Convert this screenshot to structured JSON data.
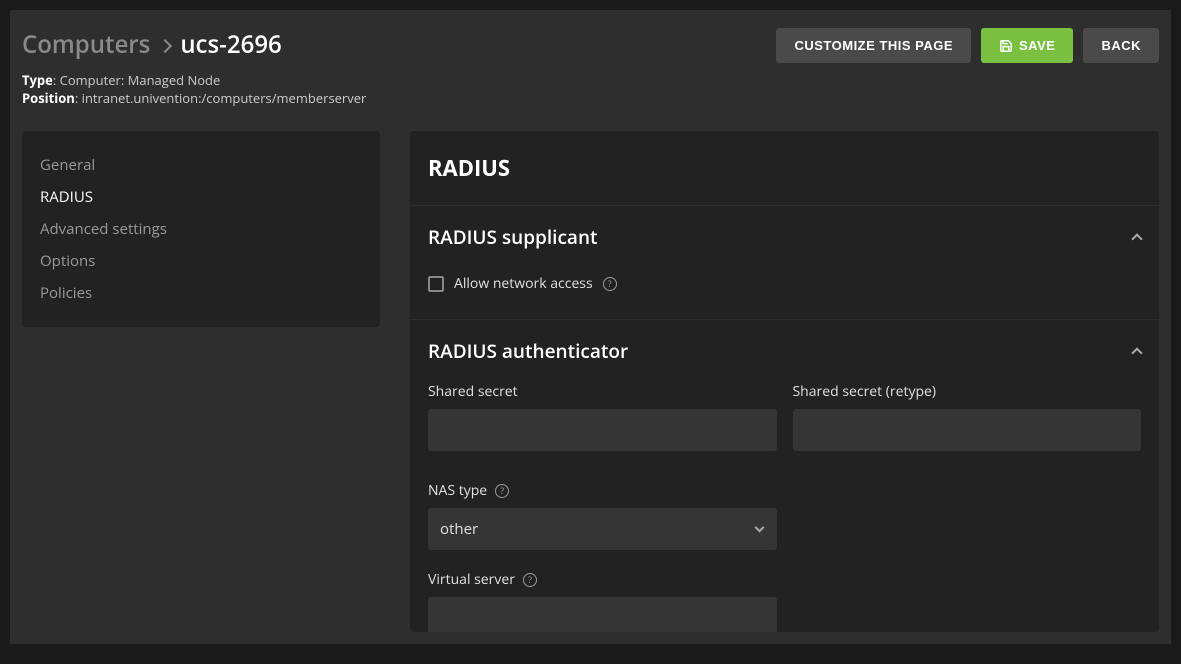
{
  "header": {
    "breadcrumb": {
      "parent": "Computers",
      "current": "ucs-2696"
    },
    "meta": {
      "type_label": "Type",
      "type_value": "Computer: Managed Node",
      "position_label": "Position",
      "position_value": "intranet.univention:/computers/memberserver"
    },
    "actions": {
      "customize": "CUSTOMIZE THIS PAGE",
      "save": "SAVE",
      "back": "BACK"
    }
  },
  "sidebar": {
    "items": [
      {
        "label": "General",
        "active": false
      },
      {
        "label": "RADIUS",
        "active": true
      },
      {
        "label": "Advanced settings",
        "active": false
      },
      {
        "label": "Options",
        "active": false
      },
      {
        "label": "Policies",
        "active": false
      }
    ]
  },
  "main": {
    "title": "RADIUS",
    "sections": {
      "supplicant": {
        "title": "RADIUS supplicant",
        "allow_network_label": "Allow network access",
        "allow_network_checked": false
      },
      "authenticator": {
        "title": "RADIUS authenticator",
        "shared_secret_label": "Shared secret",
        "shared_secret_value": "",
        "shared_secret_retype_label": "Shared secret (retype)",
        "shared_secret_retype_value": "",
        "nas_type_label": "NAS type",
        "nas_type_value": "other",
        "virtual_server_label": "Virtual server",
        "virtual_server_value": ""
      }
    }
  }
}
